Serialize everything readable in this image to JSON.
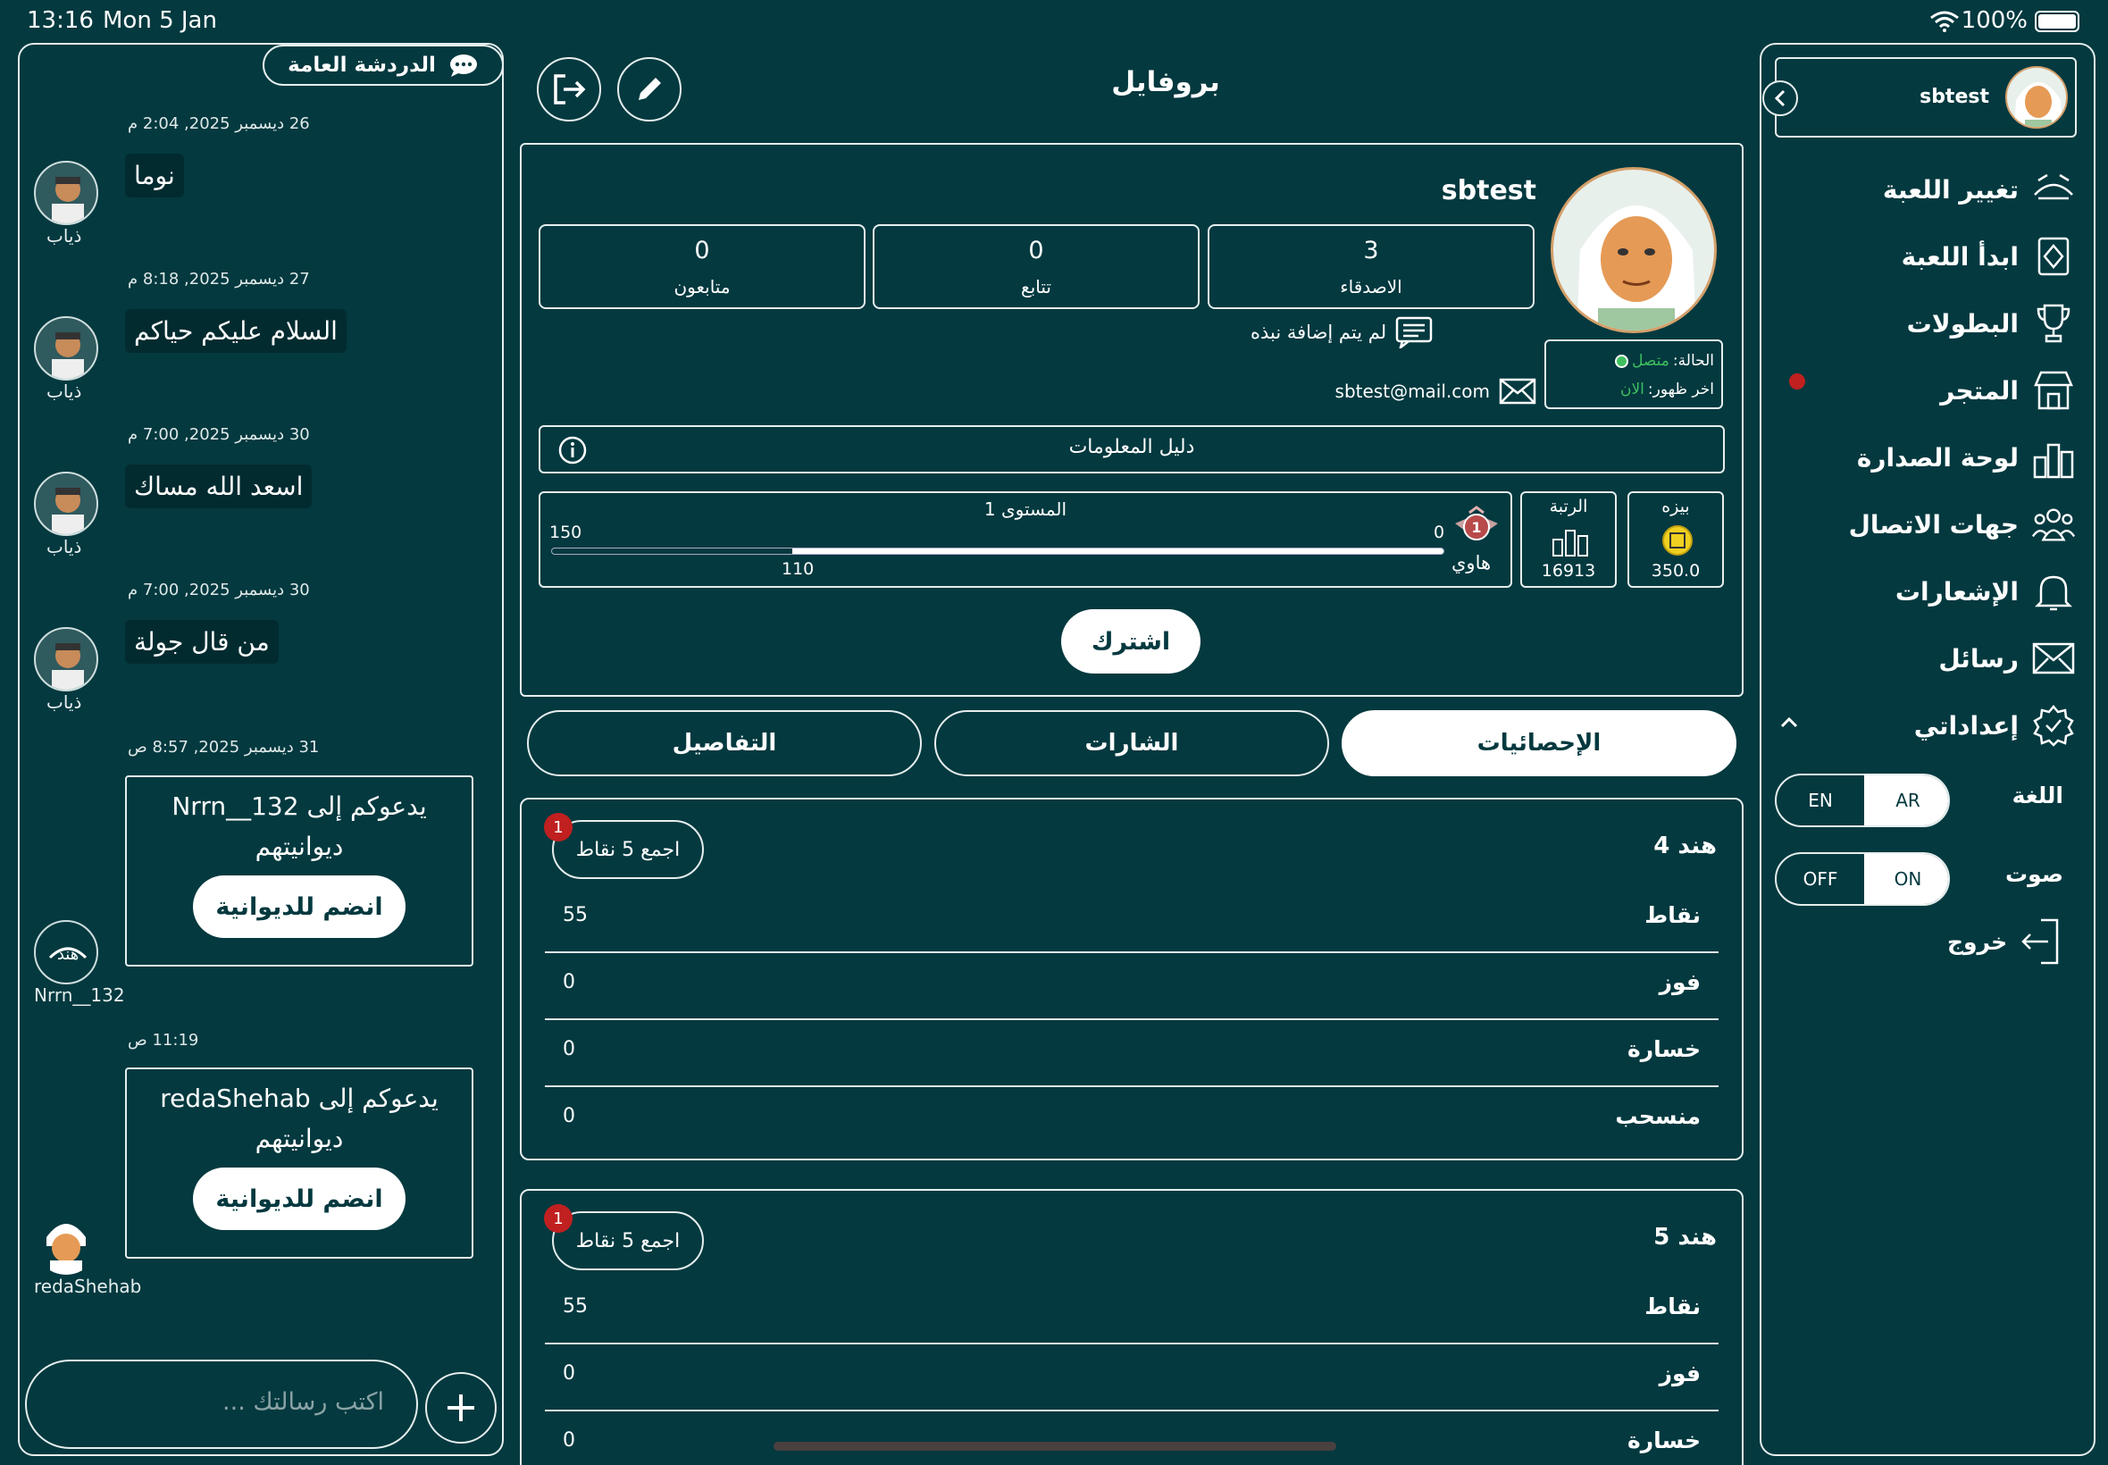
{
  "status_bar": {
    "time": "13:16",
    "date": "Mon 5 Jan",
    "battery": "100%"
  },
  "chat": {
    "title": "الدردشة العامة",
    "messages": [
      {
        "date": "26 ديسمبر 2025, 2:04 م",
        "text": "نوما",
        "user": "ذياب"
      },
      {
        "date": "27 ديسمبر 2025, 8:18 م",
        "text": "السلام عليكم حياكم",
        "user": "ذياب"
      },
      {
        "date": "30 ديسمبر 2025, 7:00 م",
        "text": "اسعد الله مساك",
        "user": "ذياب"
      },
      {
        "date": "30 ديسمبر 2025, 7:00 م",
        "text": "من قال جولة",
        "user": "ذياب"
      }
    ],
    "invites": [
      {
        "date": "31 ديسمبر 2025, 8:57 ص",
        "line1": "يدعوكم إلى Nrrn__132",
        "line2": "ديوانيتهم",
        "button": "انضم للديوانية",
        "user": "Nrrn__132"
      },
      {
        "date": "11:19 ص",
        "line1": "يدعوكم إلى redaShehab",
        "line2": "ديوانيتهم",
        "button": "انضم للديوانية",
        "user": "redaShehab"
      }
    ],
    "input_placeholder": "اكتب رسالتك ..."
  },
  "profile": {
    "title": "بروفايل",
    "username": "sbtest",
    "stats": [
      {
        "value": "3",
        "label": "الاصدقاء"
      },
      {
        "value": "0",
        "label": "تتابع"
      },
      {
        "value": "0",
        "label": "متابعون"
      }
    ],
    "bio": "لم يتم إضافة نبذه",
    "email": "sbtest@mail.com",
    "status_label": "الحالة:",
    "status_value": "متصل",
    "last_seen_label": "اخر ظهور:",
    "last_seen_value": "الان",
    "info_guide": "دليل المعلومات",
    "level_label": "المستوى 1",
    "level_min": "0",
    "level_max": "150",
    "level_current": "110",
    "level_progress": 0.73,
    "rank_title": "هاوي",
    "rank_label": "الرتبة",
    "rank_value": "16913",
    "coins_label": "بيزه",
    "coins_value": "350.0",
    "subscribe": "اشترك",
    "tabs": [
      "الإحصائيات",
      "الشارات",
      "التفاصيل"
    ],
    "accent": "#3fbf5f"
  },
  "stat_cards": [
    {
      "title": "هند 4",
      "badge_button": "اجمع 5 نقاط",
      "badge_count": "1",
      "rows": [
        {
          "label": "نقاط",
          "value": "55"
        },
        {
          "label": "فوز",
          "value": "0"
        },
        {
          "label": "خسارة",
          "value": "0"
        },
        {
          "label": "منسحب",
          "value": "0"
        }
      ]
    },
    {
      "title": "هند 5",
      "badge_button": "اجمع 5 نقاط",
      "badge_count": "1",
      "rows": [
        {
          "label": "نقاط",
          "value": "55"
        },
        {
          "label": "فوز",
          "value": "0"
        },
        {
          "label": "خسارة",
          "value": "0"
        }
      ]
    }
  ],
  "sidebar": {
    "username": "sbtest",
    "items": [
      {
        "label": "تغيير اللعبة",
        "icon": "cards-icon"
      },
      {
        "label": "ابدأ اللعبة",
        "icon": "play-cards-icon"
      },
      {
        "label": "البطولات",
        "icon": "trophy-icon"
      },
      {
        "label": "المتجر",
        "icon": "store-icon"
      },
      {
        "label": "لوحة الصدارة",
        "icon": "leaderboard-icon"
      },
      {
        "label": "جهات الاتصال",
        "icon": "contacts-icon"
      },
      {
        "label": "الإشعارات",
        "icon": "bell-icon"
      },
      {
        "label": "رسائل",
        "icon": "mail-icon"
      },
      {
        "label": "إعداداتي",
        "icon": "settings-icon"
      }
    ],
    "language_label": "اللغة",
    "lang_ar": "AR",
    "lang_en": "EN",
    "sound_label": "صوت",
    "sound_on": "ON",
    "sound_off": "OFF",
    "logout": "خروج"
  }
}
